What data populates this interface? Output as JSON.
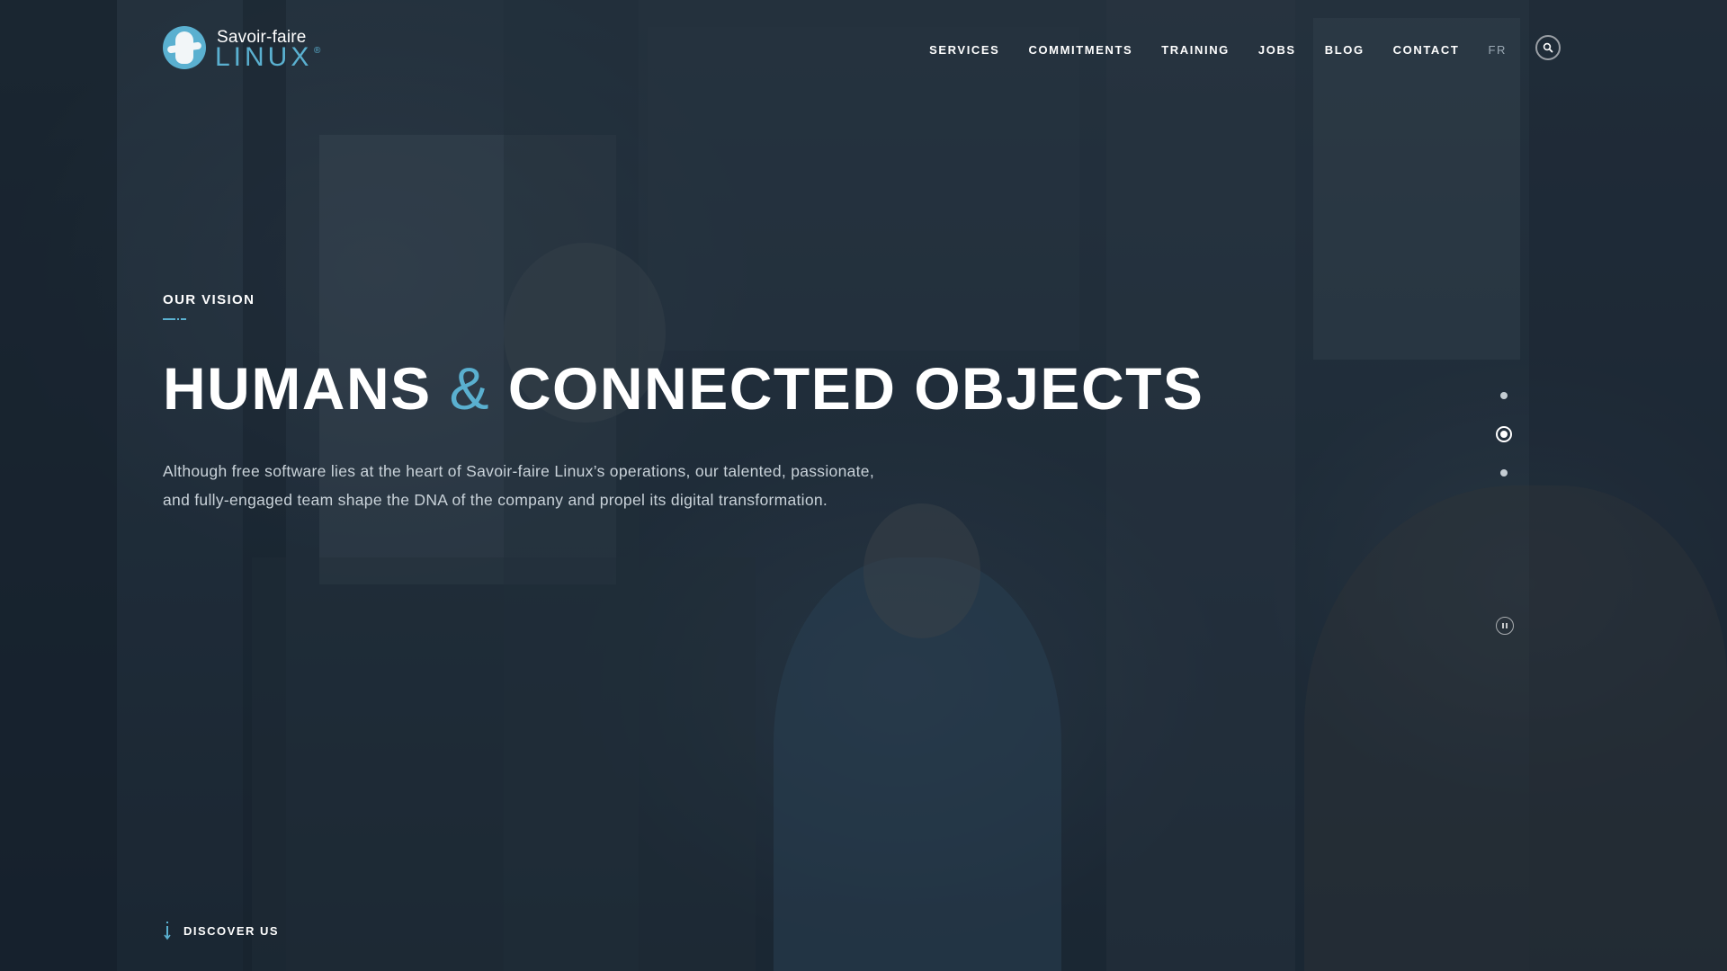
{
  "logo": {
    "line1": "Savoir-faire",
    "line2": "LINUX",
    "reg_mark": "®",
    "icon": "penguin-logo-icon"
  },
  "nav": {
    "items": [
      "SERVICES",
      "COMMITMENTS",
      "TRAINING",
      "JOBS",
      "BLOG",
      "CONTACT"
    ],
    "lang": "FR",
    "search_icon": "search-icon"
  },
  "hero": {
    "eyebrow": "OUR VISION",
    "headline_part1": "HUMANS",
    "headline_amp": "&",
    "headline_part2": "CONNECTED OBJECTS",
    "intro_line1": "Although free software lies at the heart of Savoir-faire Linux’s operations, our talented, passionate,",
    "intro_line2": "and fully-engaged team shape the DNA of the company and propel its digital transformation."
  },
  "slider": {
    "slides": 3,
    "active_index": 1,
    "pause_icon": "pause-icon"
  },
  "discover": {
    "label": "DISCOVER US",
    "icon": "arrow-down-icon"
  },
  "colors": {
    "accent": "#5ab0d0",
    "text": "#ffffff",
    "muted": "#c9d2d9",
    "overlay": "#1f2d3a"
  }
}
